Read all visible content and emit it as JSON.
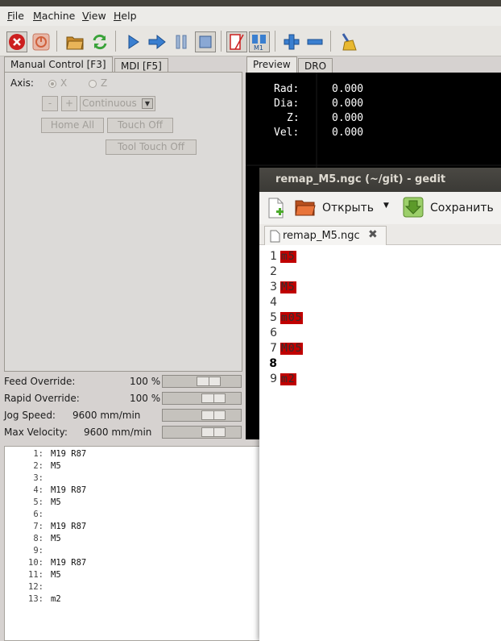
{
  "menubar": {
    "items": [
      {
        "label": "File",
        "underline": "F",
        "rest": "ile"
      },
      {
        "label": "Machine",
        "underline": "M",
        "rest": "achine"
      },
      {
        "label": "View",
        "underline": "V",
        "rest": "iew"
      },
      {
        "label": "Help",
        "underline": "H",
        "rest": "elp"
      }
    ]
  },
  "tabs_left": [
    {
      "label": "Manual Control [F3]"
    },
    {
      "label": "MDI [F5]"
    }
  ],
  "manual": {
    "axis_label": "Axis:",
    "axis_x": "X",
    "axis_z": "Z",
    "minus": "-",
    "plus": "+",
    "jog_mode": "Continuous",
    "home_all": "Home All",
    "touch_off": "Touch Off",
    "tool_touch_off": "Tool Touch Off"
  },
  "overrides": {
    "feed_label": "Feed Override:",
    "feed_value": "100 %",
    "feed_level": 0.62,
    "rapid_label": "Rapid Override:",
    "rapid_value": "100 %",
    "rapid_level": 0.72,
    "jog_label": "Jog Speed:",
    "jog_value": "9600 mm/min",
    "jog_level": 0.72,
    "maxvel_label": "Max Velocity:",
    "maxvel_value": "9600 mm/min",
    "maxvel_level": 0.72
  },
  "gcode": [
    {
      "n": "1:",
      "t": "M19 R87"
    },
    {
      "n": "2:",
      "t": "M5"
    },
    {
      "n": "3:",
      "t": ""
    },
    {
      "n": "4:",
      "t": "M19 R87"
    },
    {
      "n": "5:",
      "t": "M5"
    },
    {
      "n": "6:",
      "t": ""
    },
    {
      "n": "7:",
      "t": "M19 R87"
    },
    {
      "n": "8:",
      "t": "M5"
    },
    {
      "n": "9:",
      "t": ""
    },
    {
      "n": "10:",
      "t": "M19 R87"
    },
    {
      "n": "11:",
      "t": "M5"
    },
    {
      "n": "12:",
      "t": ""
    },
    {
      "n": "13:",
      "t": "m2"
    }
  ],
  "tabs_right": [
    {
      "label": "Preview"
    },
    {
      "label": "DRO"
    }
  ],
  "dro": {
    "rad_label": "Rad:",
    "rad_value": "0.000",
    "dia_label": "Dia:",
    "dia_value": "0.000",
    "z_label": "Z:",
    "z_value": "0.000",
    "vel_label": "Vel:",
    "vel_value": "0.000"
  },
  "gedit": {
    "title": "remap_M5.ngc (~/git) - gedit",
    "open_label": "Открыть",
    "save_label": "Сохранить",
    "tab_label": "remap_M5.ngc",
    "lines": [
      {
        "n": "1",
        "t": "m5"
      },
      {
        "n": "2",
        "t": ""
      },
      {
        "n": "3",
        "t": "M5"
      },
      {
        "n": "4",
        "t": ""
      },
      {
        "n": "5",
        "t": "m05"
      },
      {
        "n": "6",
        "t": ""
      },
      {
        "n": "7",
        "t": "M05"
      },
      {
        "n": "8",
        "t": ""
      },
      {
        "n": "9",
        "t": "m2"
      }
    ],
    "current_line": "8",
    "highlight_color": "#c00000"
  },
  "colors": {
    "estop": "#cc1f1f",
    "run": "#3a7fd0",
    "preview_bg": "#000000"
  },
  "icons": [
    "estop-icon",
    "power-icon",
    "open-file-icon",
    "reload-icon",
    "run-icon",
    "step-icon",
    "pause-icon",
    "stop-icon",
    "block-delete-icon",
    "optional-stop-icon",
    "zoom-in-icon",
    "zoom-out-icon",
    "clear-plot-icon"
  ]
}
